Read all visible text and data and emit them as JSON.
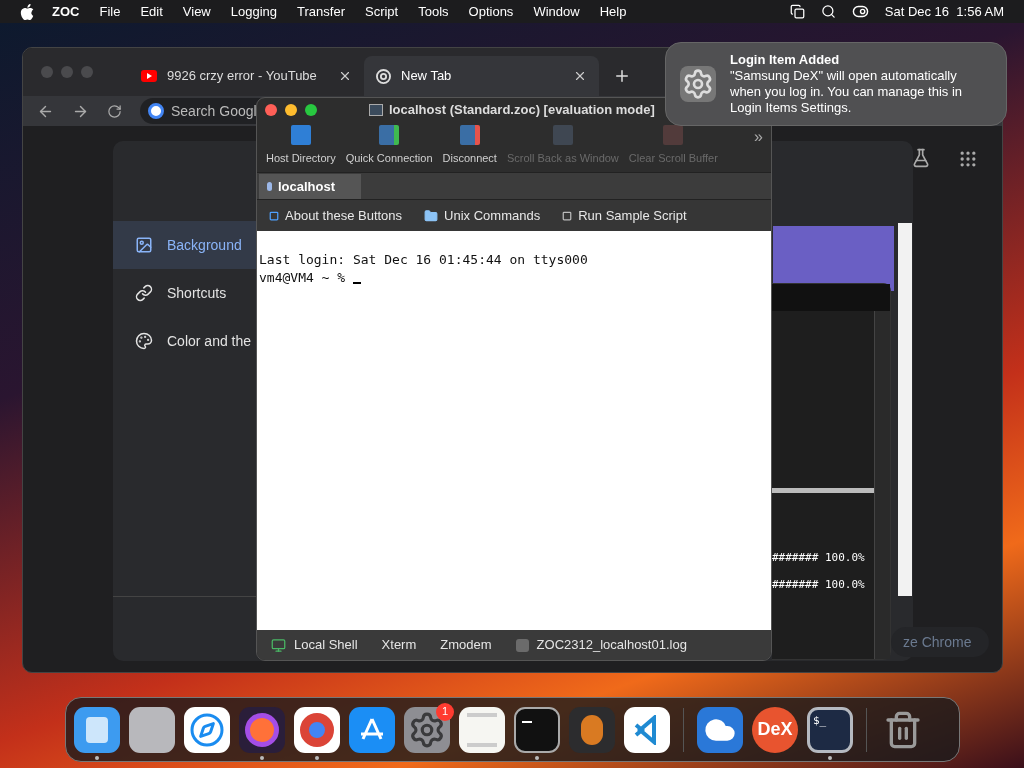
{
  "menu_bar": {
    "app": "ZOC",
    "items": [
      "File",
      "Edit",
      "View",
      "Logging",
      "Transfer",
      "Script",
      "Tools",
      "Options",
      "Window",
      "Help"
    ],
    "clock": "Sat Dec 16  1:56 AM"
  },
  "chrome": {
    "tabs": [
      {
        "title": "9926 crzy error - YouTube",
        "kind": "youtube",
        "selected": false
      },
      {
        "title": "New Tab",
        "kind": "chrome",
        "selected": true
      }
    ],
    "search_placeholder": "Search Googl",
    "sidebar": [
      {
        "label": "Background",
        "kind": "image",
        "selected": true
      },
      {
        "label": "Shortcuts",
        "kind": "link",
        "selected": false
      },
      {
        "label": "Color and the",
        "kind": "palette",
        "selected": false
      }
    ],
    "customize_button": "ze Chrome"
  },
  "background_terminal": {
    "lines": [
      "####### 100.0%",
      "####### 100.0%"
    ]
  },
  "zoc": {
    "title": "localhost (Standard.zoc) [evaluation mode]",
    "toolbar": [
      {
        "label": "Host Directory",
        "kind": "directory",
        "disabled": false
      },
      {
        "label": "Quick Connection",
        "kind": "connect",
        "disabled": false
      },
      {
        "label": "Disconnect",
        "kind": "disconnect",
        "disabled": false
      },
      {
        "label": "Scroll Back as Window",
        "kind": "scrollback",
        "disabled": true
      },
      {
        "label": "Clear Scroll Buffer",
        "kind": "clear",
        "disabled": true
      }
    ],
    "toolbar_overflow": "»",
    "tabs": [
      {
        "label": "localhost",
        "selected": true
      }
    ],
    "buttons": [
      {
        "label": "About these Buttons",
        "kind": "button"
      },
      {
        "label": "Unix Commands",
        "kind": "folder"
      },
      {
        "label": "Run Sample Script",
        "kind": "script"
      }
    ],
    "terminal_lines": [
      "Last login: Sat Dec 16 01:45:44 on ttys000",
      "vm4@VM4 ~ % "
    ],
    "status": [
      {
        "label": "Local Shell",
        "kind": "monitor"
      },
      {
        "label": "Xterm",
        "kind": "text"
      },
      {
        "label": "Zmodem",
        "kind": "text"
      },
      {
        "label": "ZOC2312_localhost01.log",
        "kind": "log"
      }
    ]
  },
  "notification": {
    "title": "Login Item Added",
    "body": "\"Samsung DeX\" will open automatically when you log in. You can manage this in Login Items Settings."
  },
  "dock": [
    {
      "kind": "finder",
      "running": true
    },
    {
      "kind": "launchpad",
      "running": false
    },
    {
      "kind": "safari",
      "running": false
    },
    {
      "kind": "firefox",
      "running": true
    },
    {
      "kind": "chrome",
      "running": true
    },
    {
      "kind": "appstore",
      "running": false
    },
    {
      "kind": "settings",
      "running": false,
      "badge": "1"
    },
    {
      "kind": "textedit",
      "running": false
    },
    {
      "kind": "terminal",
      "running": true
    },
    {
      "kind": "garageband",
      "running": false
    },
    {
      "kind": "vscode",
      "running": false
    },
    {
      "kind": "separator"
    },
    {
      "kind": "weather",
      "running": false
    },
    {
      "kind": "dex",
      "running": false,
      "label": "DeX"
    },
    {
      "kind": "zoc",
      "running": true,
      "label": "$_"
    },
    {
      "kind": "separator"
    },
    {
      "kind": "trash",
      "running": false
    }
  ]
}
